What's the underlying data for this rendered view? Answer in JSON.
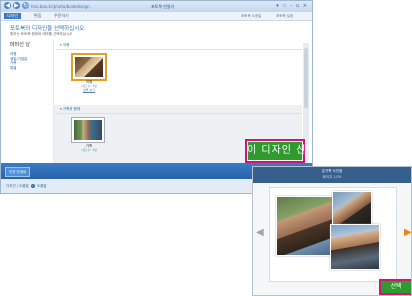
{
  "window": {
    "url_text": "hiro.boo.kr/photo/bookdesign",
    "title": "포토북 만들기",
    "controls": "▾ ☆ - ▫ ×",
    "tabs": [
      {
        "label": "디자인"
      },
      {
        "label": "편집"
      },
      {
        "label": "주문하기"
      }
    ],
    "top_links": [
      "포토북 도움말",
      "포토북 설정"
    ]
  },
  "page": {
    "heading": "포토북의 디자인을 선택하십시오",
    "subheading": "원하는 포토북 형태와 테마를 선택하십시오"
  },
  "sidebar": {
    "title": "테마선 낭",
    "items": [
      "여행",
      "생일/기념일",
      "가족",
      "특별"
    ]
  },
  "sections": [
    {
      "label": "▾ 여행",
      "thumb": {
        "name": "여행",
        "info1": "사진 수: 3장",
        "info2": "샘플 보기"
      }
    },
    {
      "label": "▾ 가족과 함께",
      "thumb": {
        "name": "가족",
        "info1": "사진 수: 3장",
        "info2": ""
      }
    }
  ],
  "select_button": {
    "label": "이 디자인 선택"
  },
  "bottom_bar": {
    "button": "이전 단계로"
  },
  "status": {
    "left": "디자인 | 도움말",
    "right": "도움말"
  },
  "preview": {
    "title": "온가족 사진첩",
    "subtitle": "페이지 1/20",
    "left_arrow": "◀",
    "right_arrow": "▶",
    "button": "선택"
  },
  "colors": {
    "accent": "#2c6db5",
    "select_green": "#2f9b2f",
    "highlight_border": "#d0157a",
    "bottom_bar": "#2863a8"
  }
}
